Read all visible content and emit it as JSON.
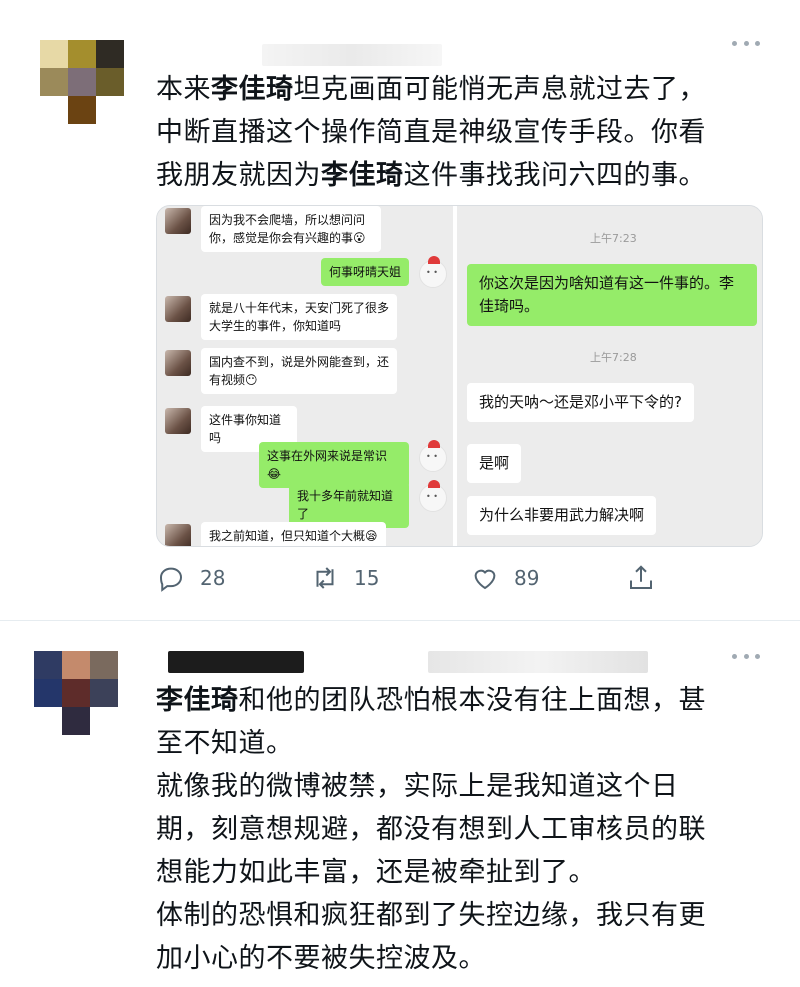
{
  "tweets": [
    {
      "text_lines": [
        [
          {
            "t": "本来"
          },
          {
            "t": "李佳琦",
            "b": true
          },
          {
            "t": "坦克画面可能悄无声息就过去了，"
          }
        ],
        [
          {
            "t": "中断直播这个操作简直是神级宣传手段。你看"
          }
        ],
        [
          {
            "t": "我朋友就因为"
          },
          {
            "t": "李佳琦",
            "b": true
          },
          {
            "t": "这件事找我问六四的事。"
          }
        ]
      ],
      "chat": {
        "left": [
          {
            "from": "friend",
            "text": "因为我不会爬墙，所以想问问你，感觉是你会有兴趣的事😮"
          },
          {
            "from": "me",
            "text": "何事呀晴天姐"
          },
          {
            "from": "friend",
            "text": "就是八十年代末，天安门死了很多大学生的事件，你知道吗"
          },
          {
            "from": "friend",
            "text": "国内查不到，说是外网能查到，还有视频😶"
          },
          {
            "from": "friend",
            "text": "这件事你知道吗"
          },
          {
            "from": "me",
            "text": "这事在外网来说是常识😂"
          },
          {
            "from": "me",
            "text": "我十多年前就知道了"
          },
          {
            "from": "friend",
            "text": "我之前知道，但只知道个大概😪"
          }
        ],
        "right": {
          "time1": "上午7:23",
          "msg1": "你这次是因为啥知道有这一件事的。李佳琦吗。",
          "time2": "上午7:28",
          "msg2": "我的天呐～还是邓小平下令的?",
          "msg3": "是啊",
          "msg4": "为什么非要用武力解决啊"
        }
      },
      "actions": {
        "reply_count": "28",
        "retweet_count": "15",
        "like_count": "89"
      }
    },
    {
      "text_lines": [
        [
          {
            "t": "李佳琦",
            "b": true
          },
          {
            "t": "和他的团队恐怕根本没有往上面想，甚"
          }
        ],
        [
          {
            "t": "至不知道。"
          }
        ],
        [
          {
            "t": "就像我的微博被禁，实际上是我知道这个日"
          }
        ],
        [
          {
            "t": "期，刻意想规避，都没有想到人工审核员的联"
          }
        ],
        [
          {
            "t": "想能力如此丰富，还是被牵扯到了。"
          }
        ],
        [
          {
            "t": "体制的恐惧和疯狂都到了失控边缘，我只有更"
          }
        ],
        [
          {
            "t": "加小心的不要被失控波及。"
          }
        ]
      ]
    }
  ],
  "colors": {
    "icon_gray": "#536471",
    "wechat_green": "#95ec69",
    "divider": "#e6ecf0"
  }
}
